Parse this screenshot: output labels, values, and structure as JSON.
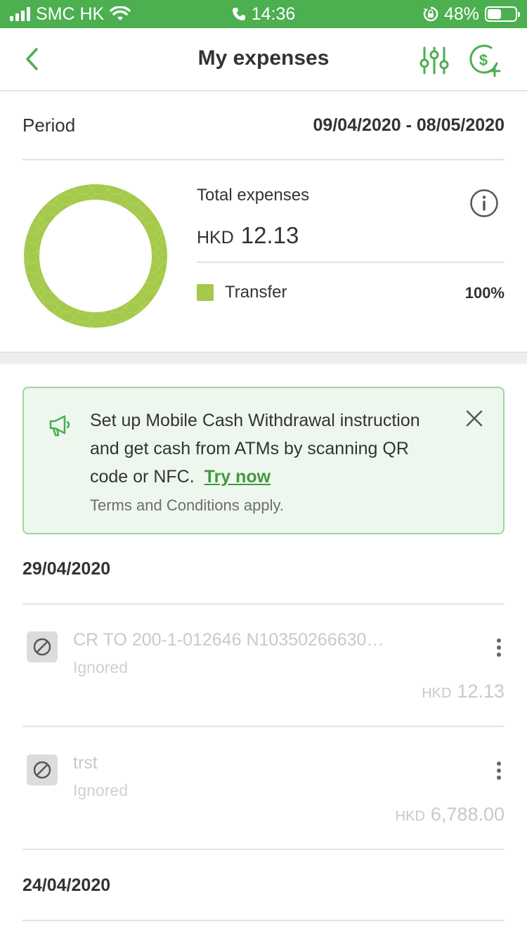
{
  "status_bar": {
    "carrier": "SMC HK",
    "time": "14:36",
    "battery": "48%",
    "battery_level": 0.48
  },
  "header": {
    "title": "My expenses",
    "icons": [
      "back-chevron-icon",
      "filter-sliders-icon",
      "add-cash-icon"
    ],
    "accent_color": "#4caf50"
  },
  "period": {
    "label": "Period",
    "value": "09/04/2020 - 08/05/2020"
  },
  "summary": {
    "total_label": "Total expenses",
    "currency": "HKD",
    "amount": "12.13",
    "legend": [
      {
        "label": "Transfer",
        "percent": "100%",
        "color": "#a4c94b"
      }
    ]
  },
  "chart_data": {
    "type": "pie",
    "categories": [
      "Transfer"
    ],
    "values": [
      100
    ]
  },
  "promo": {
    "text": "Set up Mobile Cash Withdrawal instruction and get cash from ATMs by scanning QR code or NFC.",
    "link": "Try now",
    "terms": "Terms and Conditions apply.",
    "icon": "megaphone-icon"
  },
  "groups": [
    {
      "date": "29/04/2020",
      "transactions": [
        {
          "title": "CR TO 200-1-012646 N10350266630…",
          "status": "Ignored",
          "currency": "HKD",
          "amount": "12.13"
        },
        {
          "title": "trst",
          "status": "Ignored",
          "currency": "HKD",
          "amount": "6,788.00"
        }
      ]
    },
    {
      "date": "24/04/2020",
      "transactions": []
    }
  ]
}
